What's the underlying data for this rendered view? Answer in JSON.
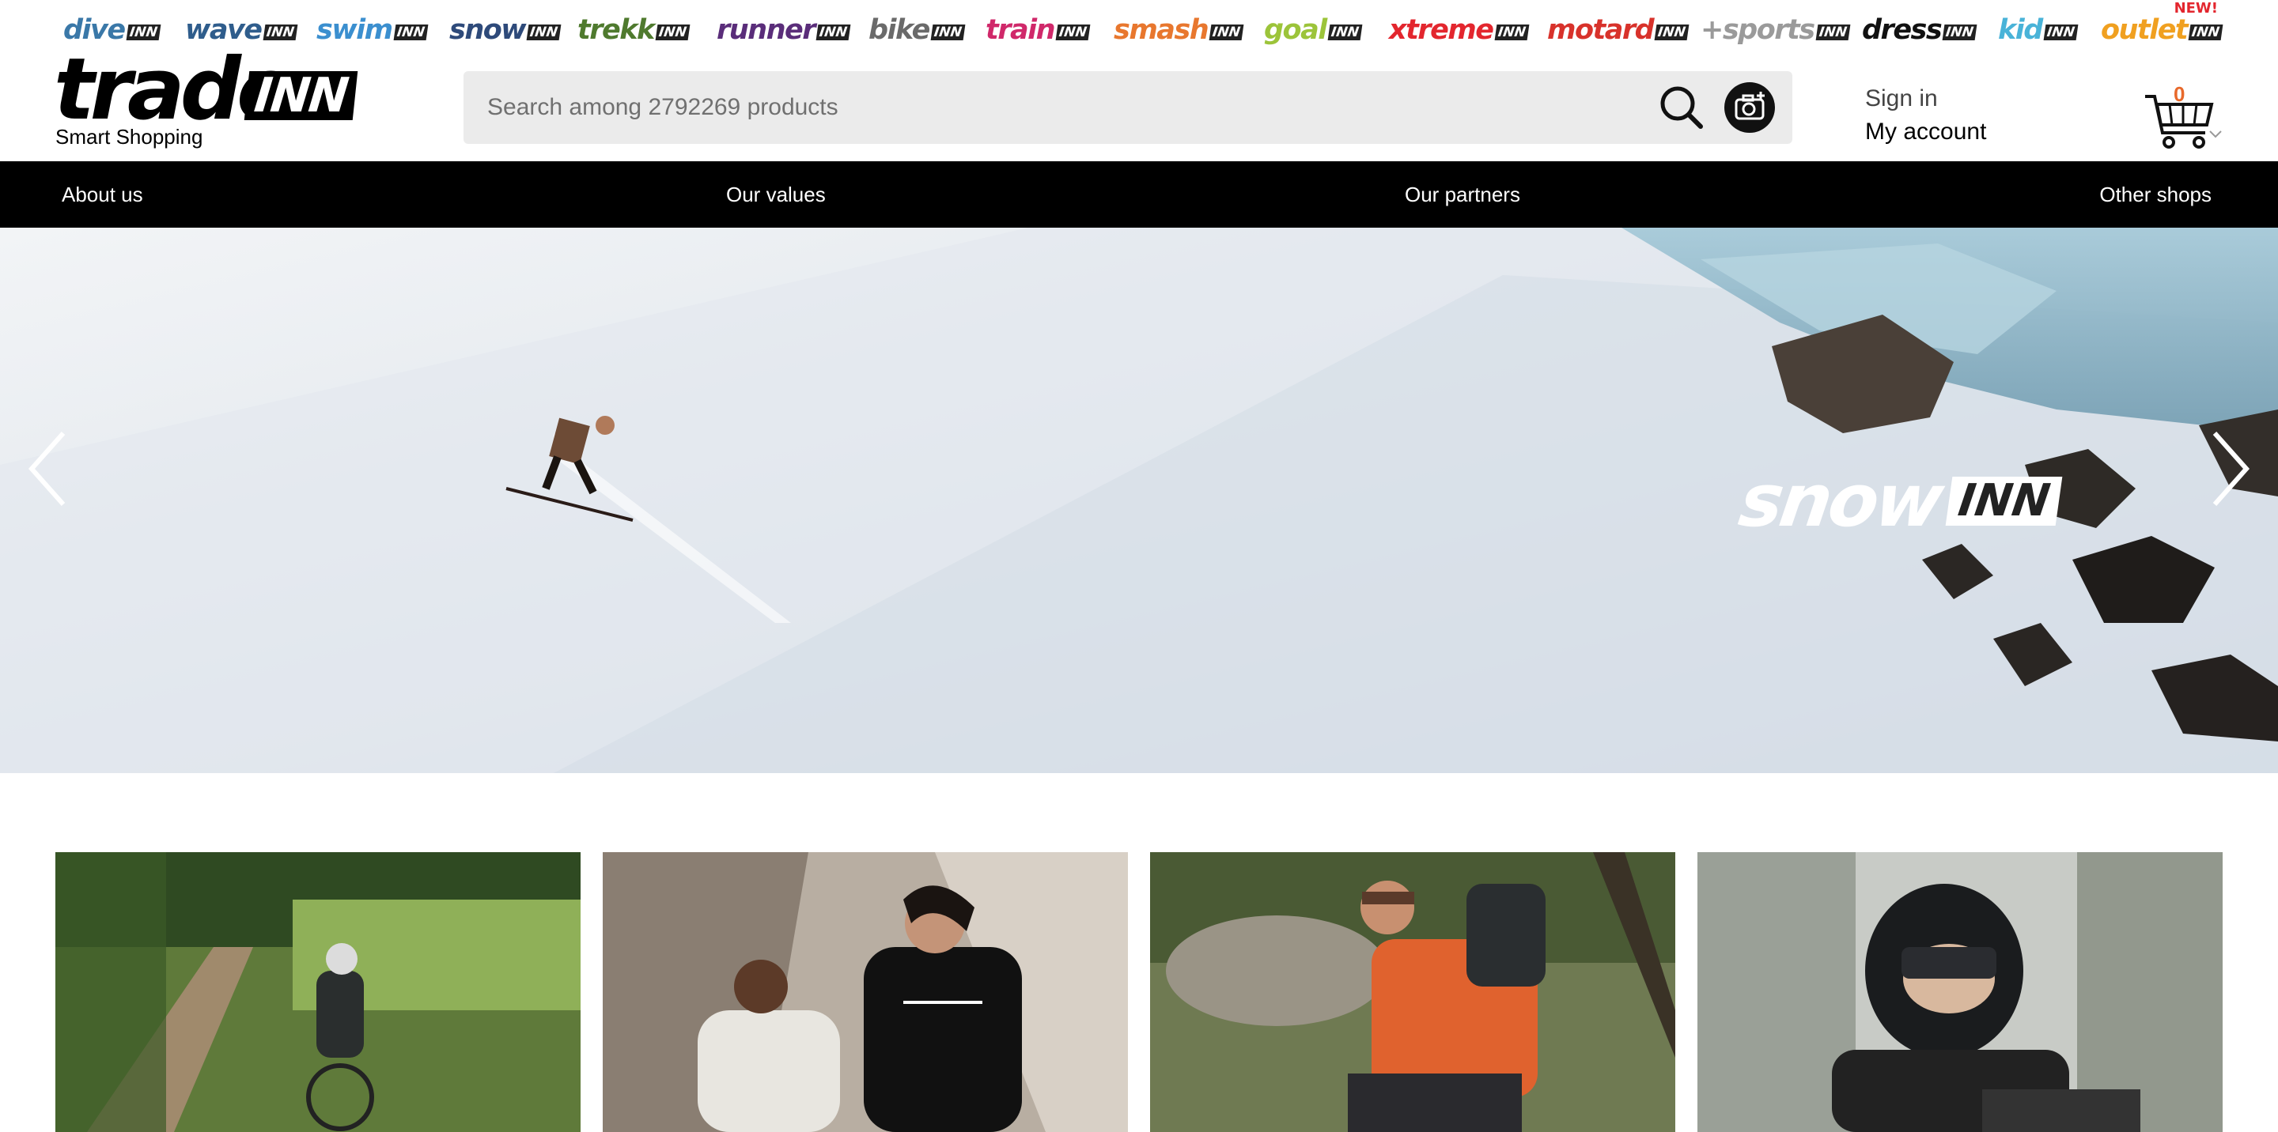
{
  "shops": [
    {
      "name": "dive",
      "badge": "INN",
      "color": "#3a78a8"
    },
    {
      "name": "wave",
      "badge": "INN",
      "color": "#2f5d8c"
    },
    {
      "name": "swim",
      "badge": "INN",
      "color": "#3b8fcf"
    },
    {
      "name": "snow",
      "badge": "INN",
      "color": "#2e4a7a"
    },
    {
      "name": "trekk",
      "badge": "INN",
      "color": "#4f7a2e"
    },
    {
      "name": "runner",
      "badge": "INN",
      "color": "#5a2d7a"
    },
    {
      "name": "bike",
      "badge": "INN",
      "color": "#6a6a6a"
    },
    {
      "name": "train",
      "badge": "INN",
      "color": "#d0286a"
    },
    {
      "name": "smash",
      "badge": "INN",
      "color": "#e8772e"
    },
    {
      "name": "goal",
      "badge": "INN",
      "color": "#9cc43a"
    },
    {
      "name": "xtreme",
      "badge": "INN",
      "color": "#e3262e"
    },
    {
      "name": "motard",
      "badge": "INN",
      "color": "#d8322b"
    },
    {
      "name": "+sports",
      "badge": "INN",
      "color": "#9a9a9a"
    },
    {
      "name": "dress",
      "badge": "INN",
      "color": "#111111"
    },
    {
      "name": "kid",
      "badge": "INN",
      "color": "#49b3d8"
    },
    {
      "name": "outlet",
      "badge": "INN",
      "color": "#f0a020",
      "flag": "NEW!"
    }
  ],
  "header": {
    "logo_word": "trade",
    "logo_badge": "INN",
    "tagline": "Smart Shopping",
    "search_placeholder": "Search among 2792269 products",
    "sign_in": "Sign in",
    "my_account": "My account",
    "cart_count": "0",
    "icons": {
      "search": "search-icon",
      "camera": "camera-search-icon",
      "cart": "cart-icon",
      "cart_dropdown": "chevron-down-icon"
    }
  },
  "nav": {
    "items": [
      "About us",
      "Our values",
      "Our partners",
      "Other shops"
    ]
  },
  "hero": {
    "brand_word": "snow",
    "brand_badge": "INN",
    "icons": {
      "prev": "chevron-left-icon",
      "next": "chevron-right-icon"
    }
  },
  "cards": [
    {
      "subject": "cyclist on forest trail"
    },
    {
      "subject": "two people in urban streetwear"
    },
    {
      "subject": "hiker tying boot"
    },
    {
      "subject": "motorcyclist with helmet"
    }
  ],
  "colors": {
    "accent_cart": "#e8692b",
    "nav_bg": "#000000",
    "search_bg": "#ebebeb"
  }
}
